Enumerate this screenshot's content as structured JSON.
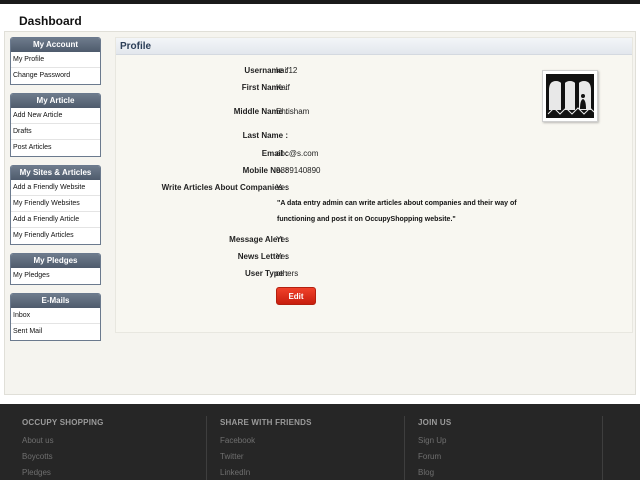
{
  "page": {
    "title": "Dashboard"
  },
  "sidebar": {
    "my_account": {
      "title": "My Account",
      "items": [
        "My Profile",
        "Change Password"
      ]
    },
    "my_article": {
      "title": "My Article",
      "items": [
        "Add New Article",
        "Drafts",
        "Post Articles"
      ]
    },
    "my_sites": {
      "title": "My Sites & Articles",
      "items": [
        "Add a Friendly Website",
        "My Friendly Websites",
        "Add a Friendly Article",
        "My Friendly Articles"
      ]
    },
    "my_pledges": {
      "title": "My Pledges",
      "items": [
        "My Pledges"
      ]
    },
    "emails": {
      "title": "E-Mails",
      "items": [
        "Inbox",
        "Sent Mail"
      ]
    }
  },
  "profile": {
    "title": "Profile",
    "fields": {
      "username": {
        "label": "Username :",
        "value": "kaif12"
      },
      "first_name": {
        "label": "First Name :",
        "value": "Kaif"
      },
      "middle_name": {
        "label": "Middle Name :",
        "value": "Ehtisham"
      },
      "last_name": {
        "label": "Last Name :",
        "value": ""
      },
      "email": {
        "label": "Email :",
        "value": "abc@s.com"
      },
      "mobile": {
        "label": "Mobile No. :",
        "value": "9889140890"
      },
      "write_articles": {
        "label": "Write Articles About Companies :",
        "value": "Yes"
      },
      "message_alert": {
        "label": "Message Alert :",
        "value": "Yes"
      },
      "news_letter": {
        "label": "News Letter :",
        "value": "Yes"
      },
      "user_type": {
        "label": "User Type :",
        "value": "others"
      }
    },
    "description_line1": "\"A data entry admin can write articles about companies and their way of",
    "description_line2": "functioning and post it on OccupyShopping website.\"",
    "edit_label": "Edit"
  },
  "footer": {
    "col1": {
      "title": "OCCUPY SHOPPING",
      "links": [
        "About us",
        "Boycotts",
        "Pledges"
      ]
    },
    "col2": {
      "title": "SHARE WITH FRIENDS",
      "links": [
        "Facebook",
        "Twitter",
        "LinkedIn"
      ]
    },
    "col3": {
      "title": "JOIN US",
      "links": [
        "Sign Up",
        "Forum",
        "Blog"
      ]
    }
  },
  "colors": {
    "accent_red": "#d9271a",
    "sidebar_header": "#5e6b7c",
    "footer_bg": "#262626"
  }
}
